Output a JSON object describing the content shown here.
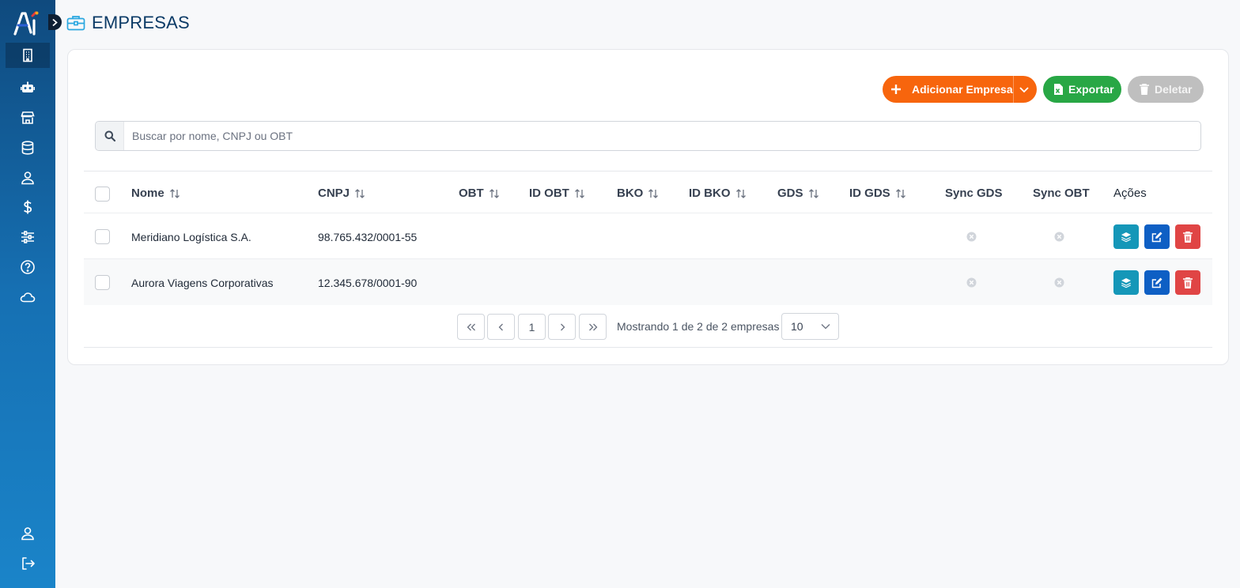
{
  "sidebar": {
    "items": [
      {
        "icon": "building-icon",
        "active": true
      },
      {
        "icon": "robot-icon"
      },
      {
        "icon": "store-icon"
      },
      {
        "icon": "database-icon"
      },
      {
        "icon": "user-icon"
      },
      {
        "icon": "dollar-icon"
      },
      {
        "icon": "sliders-icon"
      },
      {
        "icon": "help-icon"
      },
      {
        "icon": "cloud-icon"
      }
    ],
    "bottom": [
      {
        "icon": "user-icon"
      },
      {
        "icon": "logout-icon"
      }
    ]
  },
  "header": {
    "title": "EMPRESAS",
    "icon": "briefcase-icon"
  },
  "toolbar": {
    "add_label": "Adicionar Empresa",
    "export_label": "Exportar",
    "delete_label": "Deletar"
  },
  "search": {
    "placeholder": "Buscar por nome, CNPJ ou OBT",
    "value": ""
  },
  "table": {
    "columns": [
      "Nome",
      "CNPJ",
      "OBT",
      "ID OBT",
      "BKO",
      "ID BKO",
      "GDS",
      "ID GDS",
      "Sync GDS",
      "Sync OBT",
      "Ações"
    ],
    "rows": [
      {
        "nome": "Meridiano Logística S.A.",
        "cnpj": "98.765.432/0001-55",
        "obt": "",
        "id_obt": "",
        "bko": "",
        "id_bko": "",
        "gds": "",
        "id_gds": "",
        "sync_gds": "off",
        "sync_obt": "off"
      },
      {
        "nome": "Aurora Viagens Corporativas",
        "cnpj": "12.345.678/0001-90",
        "obt": "",
        "id_obt": "",
        "bko": "",
        "id_bko": "",
        "gds": "",
        "id_gds": "",
        "sync_gds": "off",
        "sync_obt": "off"
      }
    ]
  },
  "pagination": {
    "current_page": "1",
    "info": "Mostrando 1 de 2 de 2 empresas",
    "page_size": "10"
  },
  "colors": {
    "sidebar_top": "#0f4a7e",
    "sidebar_bottom": "#1a84c9",
    "add": "#f7650d",
    "export": "#28a745",
    "delete_disabled": "#bfbfbf",
    "action_layers": "#1597b8",
    "action_edit": "#0e5fc4",
    "action_delete": "#e04545"
  }
}
